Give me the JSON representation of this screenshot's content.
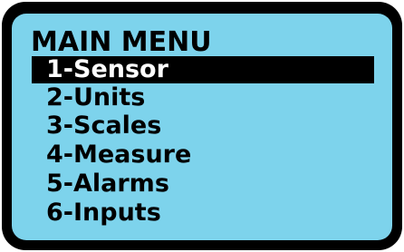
{
  "menu": {
    "title": "MAIN MENU",
    "items": [
      {
        "label": "1-Sensor",
        "selected": true
      },
      {
        "label": "2-Units",
        "selected": false
      },
      {
        "label": "3-Scales",
        "selected": false
      },
      {
        "label": "4-Measure",
        "selected": false
      },
      {
        "label": "5-Alarms",
        "selected": false
      },
      {
        "label": "6-Inputs",
        "selected": false
      }
    ]
  },
  "colors": {
    "screen": "#7dd3ec",
    "bezel": "#000000",
    "highlight": "#000000",
    "highlight_text": "#ffffff",
    "text": "#000000"
  }
}
